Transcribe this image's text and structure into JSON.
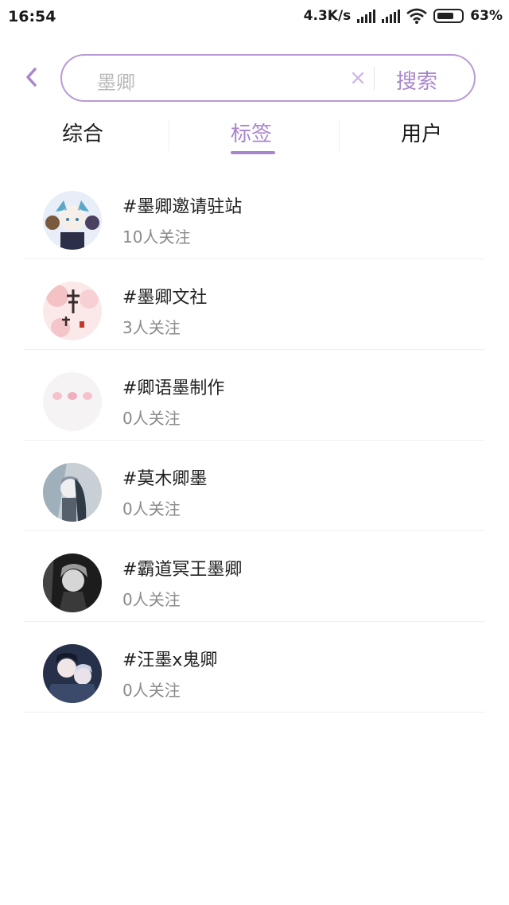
{
  "status_bar": {
    "time": "16:54",
    "network_speed": "4.3K/s",
    "battery_percent": "63%",
    "icons": [
      "signal-icon",
      "signal-icon",
      "wifi-icon",
      "battery-icon"
    ]
  },
  "search": {
    "query": "墨卿",
    "button_label": "搜索",
    "icons": [
      "back-chevron-icon",
      "clear-icon"
    ]
  },
  "tabs": [
    {
      "label": "综合",
      "active": false
    },
    {
      "label": "标签",
      "active": true
    },
    {
      "label": "用户",
      "active": false
    }
  ],
  "colors": {
    "accent": "#a986cc",
    "search_border": "#b89bd6",
    "subtext": "#8a8a8a"
  },
  "results": [
    {
      "title": "#墨卿邀请驻站",
      "followers": "10人关注"
    },
    {
      "title": "#墨卿文社",
      "followers": "3人关注"
    },
    {
      "title": "#卿语墨制作",
      "followers": "0人关注"
    },
    {
      "title": "#莫木卿墨",
      "followers": "0人关注"
    },
    {
      "title": "#霸道冥王墨卿",
      "followers": "0人关注"
    },
    {
      "title": "#汪墨x鬼卿",
      "followers": "0人关注"
    }
  ]
}
